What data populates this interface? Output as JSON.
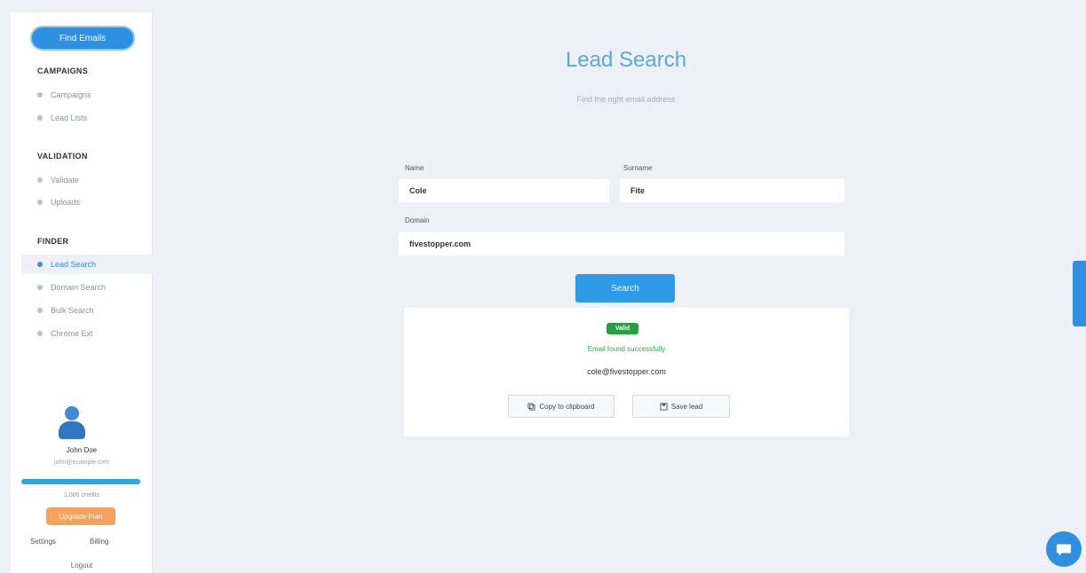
{
  "sidebar": {
    "primary_button": "Find Emails",
    "sections": [
      {
        "title": "CAMPAIGNS",
        "items": [
          "Campaigns",
          "Lead Lists"
        ]
      },
      {
        "title": "VALIDATION",
        "items": [
          "Validate",
          "Uploads"
        ]
      },
      {
        "title": "FINDER",
        "items": [
          "Lead Search",
          "Domain Search",
          "Bulk Search",
          "Chrome Ext"
        ]
      }
    ],
    "user": {
      "name": "John Doe",
      "subtitle": "john@example.com",
      "credits_text": "1,000 credits",
      "upgrade_label": "Upgrade Plan"
    },
    "footer_links": [
      "Settings",
      "Billing"
    ],
    "logout_label": "Logout"
  },
  "main": {
    "title": "Lead Search",
    "subtitle": "Find the right email address",
    "form": {
      "first_name_label": "Name",
      "first_name_value": "Cole",
      "last_name_label": "Surname",
      "last_name_value": "Fite",
      "domain_label": "Domain",
      "domain_value": "fivestopper.com",
      "submit_label": "Search"
    },
    "result": {
      "badge": "Valid",
      "status": "Email found successfully",
      "email": "cole@fivestopper.com",
      "copy_label": "Copy to clipboard",
      "save_label": "Save lead"
    }
  },
  "colors": {
    "accent": "#2f8fe0",
    "success": "#2a9f3e",
    "upgrade": "#f5a25c"
  },
  "icons": {
    "feedback": "feedback-tab-icon",
    "chat": "chat-icon"
  }
}
